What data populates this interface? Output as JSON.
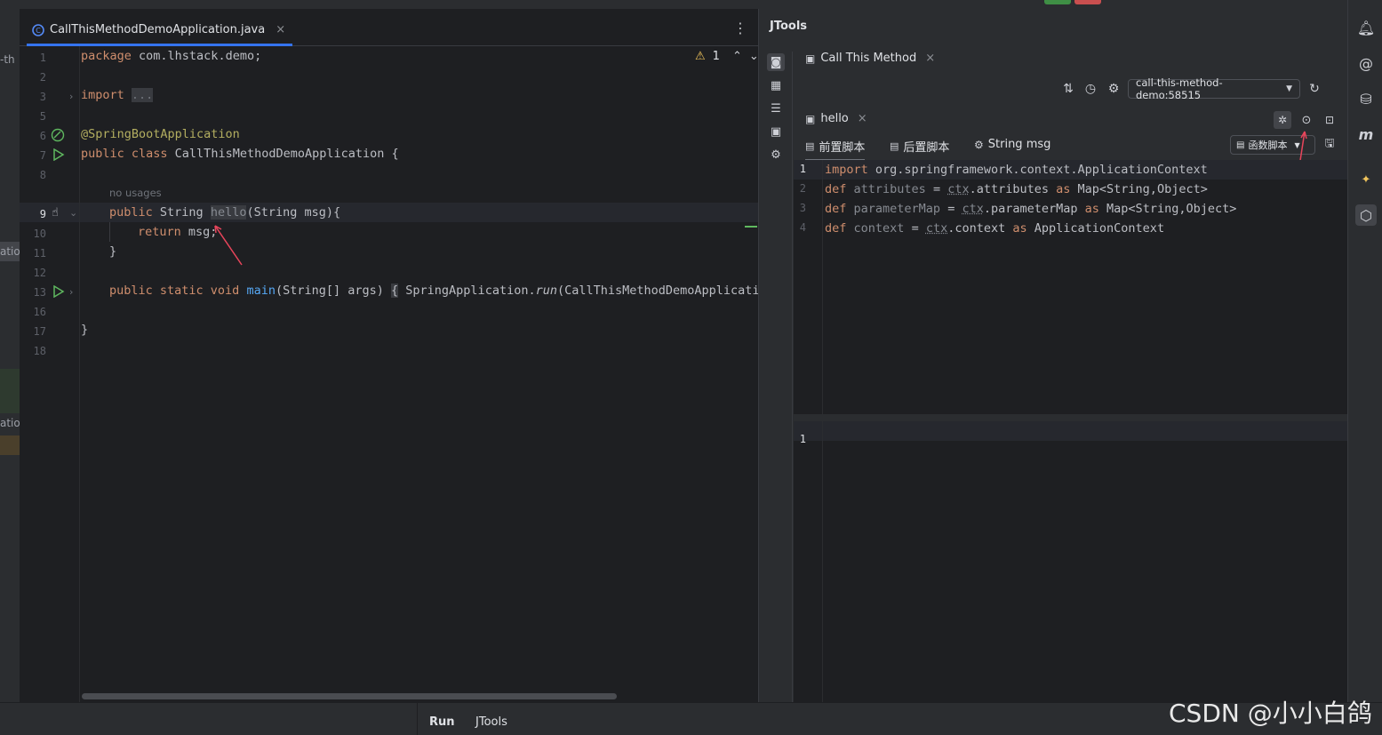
{
  "editor": {
    "file_tab": {
      "name": "CallThisMethodDemoApplication.java",
      "close": "×"
    },
    "more": "⋮",
    "inspection": {
      "warning_count": "1"
    },
    "lines": [
      {
        "n": "1"
      },
      {
        "n": "2"
      },
      {
        "n": "3"
      },
      {
        "n": "5"
      },
      {
        "n": "6"
      },
      {
        "n": "7"
      },
      {
        "n": "8"
      },
      {
        "n": "9"
      },
      {
        "n": "10"
      },
      {
        "n": "11"
      },
      {
        "n": "12"
      },
      {
        "n": "13"
      },
      {
        "n": "16"
      },
      {
        "n": "17"
      },
      {
        "n": "18"
      }
    ],
    "code": {
      "l1": [
        "package",
        " com.lhstack.demo;"
      ],
      "l3": [
        "import",
        " ",
        "..."
      ],
      "l6": "@SpringBootApplication",
      "l7": [
        "public class",
        " CallThisMethodDemoApplication {"
      ],
      "hint": "no usages",
      "l9": [
        "public",
        " String ",
        "hello",
        "(String msg){"
      ],
      "l10": [
        "return",
        " msg;"
      ],
      "l11": "}",
      "l13": [
        "public static void",
        " ",
        "main",
        "(String[] args) ",
        "{",
        " SpringApplication.",
        "run",
        "(CallThisMethodDemoApplicatio"
      ],
      "l17": "}"
    },
    "left_fragments": [
      "-th",
      "atio",
      "atio"
    ]
  },
  "tool": {
    "title": "JTools",
    "tab": {
      "label": "Call This Method",
      "close": "×"
    },
    "process_select": "call-this-method-demo:58515",
    "method_tab": {
      "label": "hello",
      "close": "×"
    },
    "subtabs": [
      "前置脚本",
      "后置脚本",
      "String msg"
    ],
    "func_select": "函数脚本",
    "script": {
      "l1": [
        "import",
        " org.springframework.context.ApplicationContext"
      ],
      "l2": [
        "def",
        " ",
        "attributes",
        " = ",
        "ctx",
        ".attributes ",
        "as",
        " Map<String,Object>"
      ],
      "l3": [
        "def",
        " ",
        "parameterMap",
        " = ",
        "ctx",
        ".parameterMap ",
        "as",
        " Map<String,Object>"
      ],
      "l4": [
        "def",
        " ",
        "context",
        " = ",
        "ctx",
        ".context ",
        "as",
        " ApplicationContext"
      ],
      "line_numbers": [
        "1",
        "2",
        "3",
        "4"
      ]
    },
    "output": {
      "line_numbers": [
        "1"
      ]
    }
  },
  "bottom": {
    "tabs": [
      "Run",
      "JTools"
    ]
  },
  "watermark": "CSDN @小小白鸽",
  "colors": {
    "accent": "#3574f0",
    "keyword": "#cf8e6d",
    "annotation": "#b3ae60",
    "function": "#56a8f5",
    "arrow": "#e8455b"
  }
}
